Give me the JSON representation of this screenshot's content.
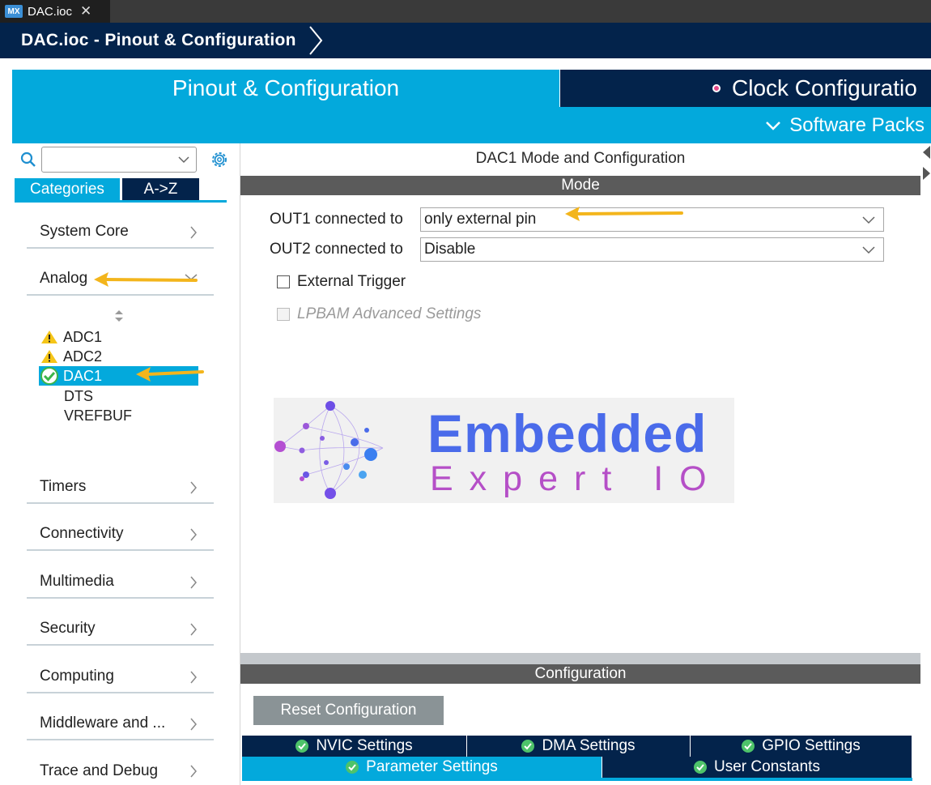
{
  "window": {
    "file_tab": "DAC.ioc",
    "app_badge": "MX"
  },
  "breadcrumb": {
    "title": "DAC.ioc - Pinout & Configuration"
  },
  "main_tabs": {
    "pinout": "Pinout & Configuration",
    "clock": "Clock Configuratio",
    "software_packs": "Software Packs"
  },
  "sidebar": {
    "search_placeholder": "",
    "tabs": {
      "categories": "Categories",
      "az": "A->Z"
    },
    "categories": [
      {
        "label": "System Core"
      },
      {
        "label": "Analog"
      },
      {
        "label": "Timers"
      },
      {
        "label": "Connectivity"
      },
      {
        "label": "Multimedia"
      },
      {
        "label": "Security"
      },
      {
        "label": "Computing"
      },
      {
        "label": "Middleware and ..."
      },
      {
        "label": "Trace and Debug"
      }
    ],
    "analog_items": [
      {
        "label": "ADC1",
        "status": "warning"
      },
      {
        "label": "ADC2",
        "status": "warning"
      },
      {
        "label": "DAC1",
        "status": "ok",
        "selected": true
      },
      {
        "label": "DTS",
        "status": "none"
      },
      {
        "label": "VREFBUF",
        "status": "none"
      }
    ]
  },
  "panel": {
    "title": "DAC1 Mode and Configuration",
    "mode_header": "Mode",
    "out1_label": "OUT1 connected to",
    "out1_value": "only external pin",
    "out2_label": "OUT2 connected to",
    "out2_value": "Disable",
    "external_trigger": "External Trigger",
    "lpbam": "LPBAM Advanced Settings",
    "logo_line1": "Embedded",
    "logo_line2": "Expert IO",
    "config_header": "Configuration",
    "reset_button": "Reset Configuration",
    "config_tabs": {
      "nvic": "NVIC Settings",
      "dma": "DMA Settings",
      "gpio": "GPIO Settings",
      "parameter": "Parameter Settings",
      "user_constants": "User Constants"
    }
  },
  "colors": {
    "st_blue": "#03a9dc",
    "st_navy": "#03234b",
    "annotation_arrow": "#f3b51c"
  }
}
